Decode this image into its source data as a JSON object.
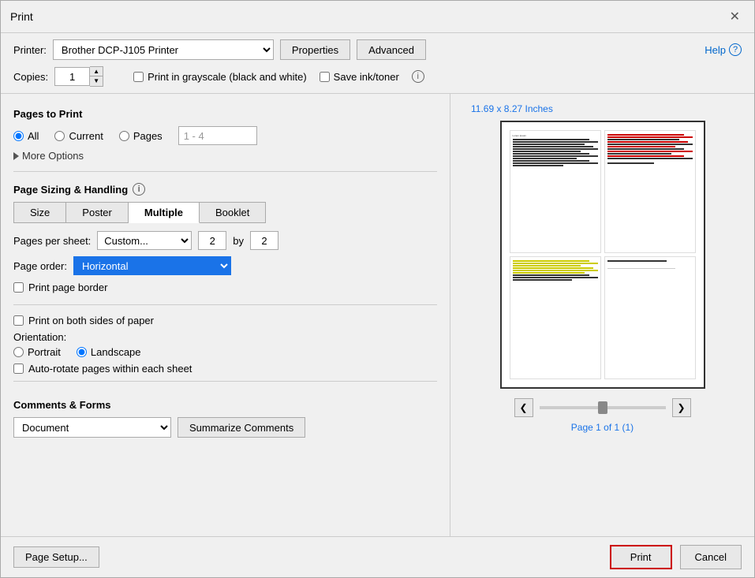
{
  "dialog": {
    "title": "Print",
    "close_label": "✕"
  },
  "help": {
    "label": "Help",
    "circle": "?"
  },
  "printer": {
    "label": "Printer:",
    "value": "Brother DCP-J105 Printer",
    "properties_label": "Properties",
    "advanced_label": "Advanced"
  },
  "copies": {
    "label": "Copies:",
    "value": "1"
  },
  "grayscale": {
    "label": "Print in grayscale (black and white)",
    "save_ink_label": "Save ink/toner"
  },
  "pages_to_print": {
    "title": "Pages to Print",
    "all_label": "All",
    "current_label": "Current",
    "pages_label": "Pages",
    "pages_value": "1 - 4",
    "more_options_label": "More Options"
  },
  "page_sizing": {
    "title": "Page Sizing & Handling",
    "info_icon": "i",
    "tabs": [
      {
        "label": "Size"
      },
      {
        "label": "Poster"
      },
      {
        "label": "Multiple"
      },
      {
        "label": "Booklet"
      }
    ],
    "active_tab": "Multiple",
    "pps_label": "Pages per sheet:",
    "pps_value": "Custom...",
    "by_label": "by",
    "pps_x": "2",
    "pps_y": "2",
    "page_order_label": "Page order:",
    "page_order_value": "Horizontal",
    "print_border_label": "Print page border",
    "both_sides_label": "Print on both sides of paper",
    "orientation_label": "Orientation:",
    "portrait_label": "Portrait",
    "landscape_label": "Landscape",
    "auto_rotate_label": "Auto-rotate pages within each sheet"
  },
  "comments_forms": {
    "title": "Comments & Forms",
    "document_value": "Document",
    "summarize_label": "Summarize Comments"
  },
  "preview": {
    "dimensions": "11.69 x 8.27 Inches",
    "page_info": "Page 1 of 1 (1)"
  },
  "bottom": {
    "page_setup_label": "Page Setup...",
    "print_label": "Print",
    "cancel_label": "Cancel"
  }
}
